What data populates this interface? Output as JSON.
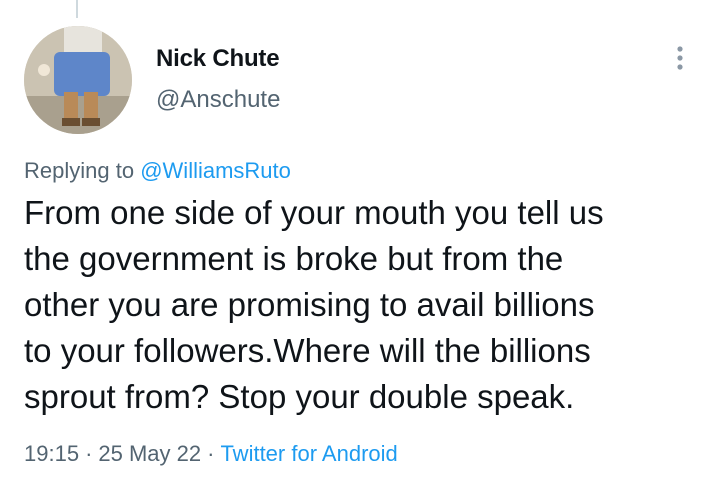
{
  "tweet": {
    "author_name": "Nick Chute",
    "author_handle": "@Anschute",
    "reply_prefix": "Replying to",
    "reply_to": "@WilliamsRuto",
    "lines": [
      "From one side of your mouth you tell us",
      "the government is broke but from the",
      "other you are promising to avail billions",
      "to your followers.Where will the billions",
      "sprout from? Stop your double speak."
    ],
    "time": "19:15",
    "separator": "·",
    "date": "25 May 22",
    "source": "Twitter for Android"
  },
  "icons": {
    "more": "more-vertical-icon"
  },
  "colors": {
    "text": "#0f1419",
    "secondary": "#536471",
    "link": "#1d9bf0"
  }
}
